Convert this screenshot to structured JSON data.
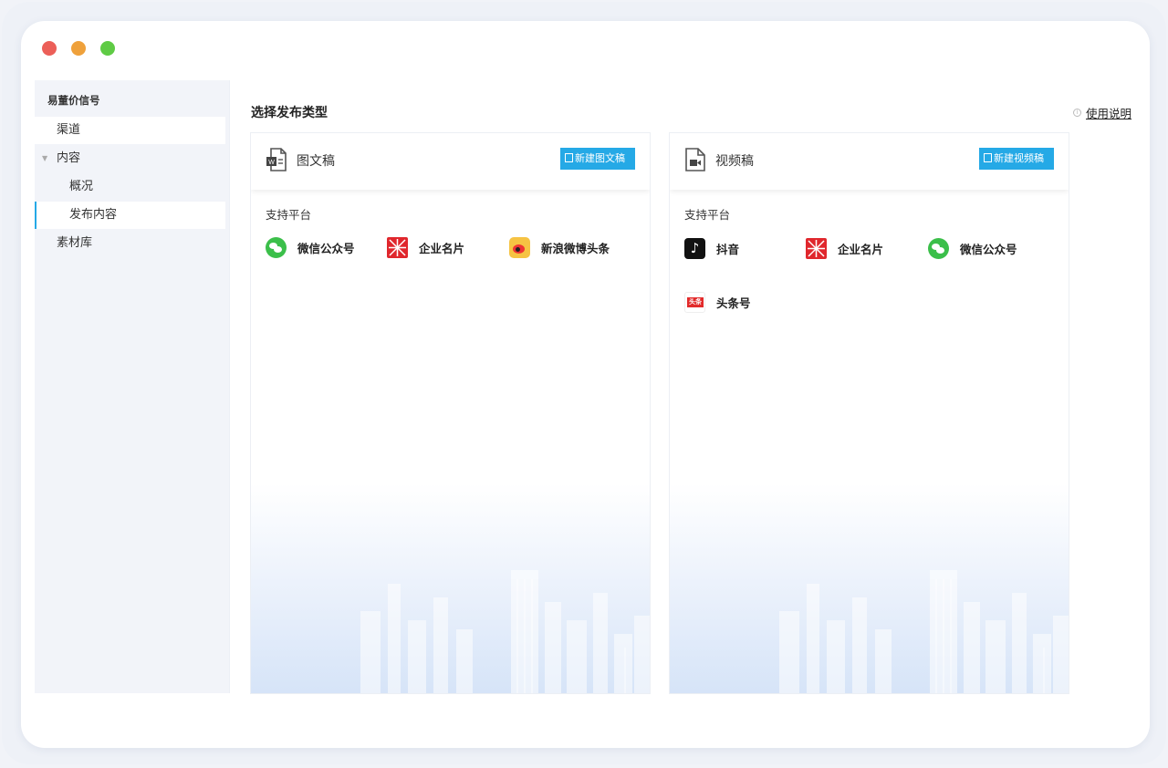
{
  "window": {
    "controls": [
      "close",
      "minimize",
      "maximize"
    ],
    "colors": {
      "close": "#ec5f58",
      "minimize": "#efa13b",
      "maximize": "#5fcb45"
    }
  },
  "sidebar": {
    "title": "易董价信号",
    "items": [
      {
        "label": "渠道",
        "level": 1
      },
      {
        "label": "内容",
        "level": 1,
        "expandable": true,
        "expanded": true
      },
      {
        "label": "概况",
        "level": 2
      },
      {
        "label": "发布内容",
        "level": 2,
        "active": true
      },
      {
        "label": "素材库",
        "level": 1
      }
    ],
    "accent": "#25a9e6"
  },
  "main": {
    "title": "选择发布类型",
    "help": {
      "icon": "info-icon",
      "label": "使用说明"
    },
    "cards": [
      {
        "title": "图文稿",
        "icon": "word-document-icon",
        "button": "新建图文稿",
        "support_label": "支持平台",
        "platforms": [
          {
            "name": "微信公众号",
            "icon": "wechat-icon"
          },
          {
            "name": "企业名片",
            "icon": "business-card-icon"
          },
          {
            "name": "新浪微博头条",
            "icon": "weibo-icon"
          }
        ]
      },
      {
        "title": "视频稿",
        "icon": "video-document-icon",
        "button": "新建视频稿",
        "support_label": "支持平台",
        "platforms": [
          {
            "name": "抖音",
            "icon": "douyin-icon"
          },
          {
            "name": "企业名片",
            "icon": "business-card-icon"
          },
          {
            "name": "微信公众号",
            "icon": "wechat-icon"
          },
          {
            "name": "头条号",
            "icon": "toutiao-icon"
          }
        ]
      }
    ],
    "button_color": "#25a9e6"
  }
}
